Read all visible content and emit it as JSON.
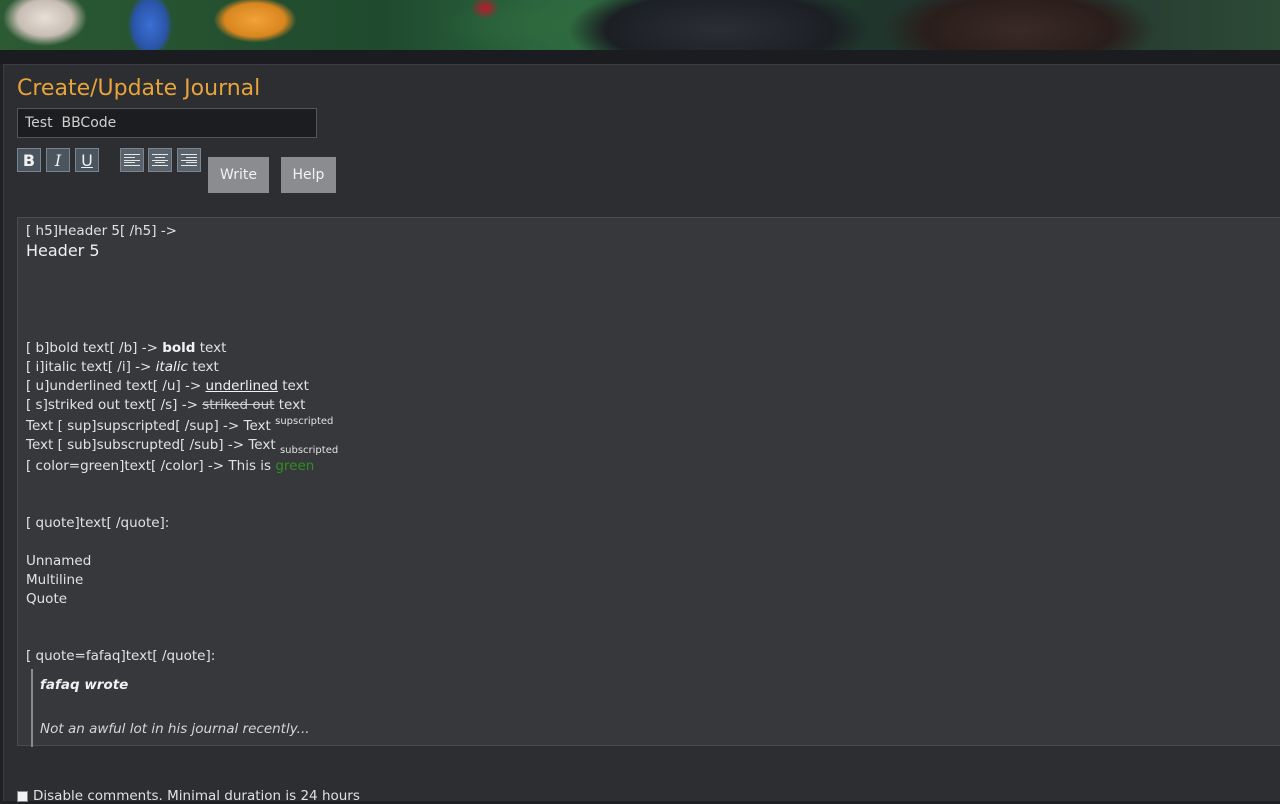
{
  "page": {
    "title": "Create/Update Journal"
  },
  "form": {
    "journal_title_value": "Test  BBCode"
  },
  "toolbar": {
    "bold_label": "B",
    "italic_label": "I",
    "underline_label": "U",
    "write_label": "Write",
    "help_label": "Help"
  },
  "preview": {
    "h5_code": "[ h5]Header 5[ /h5] ->",
    "h5_rendered": "Header 5",
    "bold": {
      "code": "[ b]bold text[ /b] -> ",
      "styled": "bold",
      "suffix": " text"
    },
    "italic": {
      "code": "[ i]italic text[ /i] -> ",
      "styled": "italic",
      "suffix": " text"
    },
    "underline": {
      "code": "[ u]underlined text[ /u] -> ",
      "styled": "underlined",
      "suffix": " text"
    },
    "strike": {
      "code": "[ s]striked out text[ /s] -> ",
      "styled": "striked out",
      "suffix": " text"
    },
    "sup": {
      "code": "Text [ sup]supscripted[ /sup] -> Text ",
      "styled": "supscripted"
    },
    "sub": {
      "code": "Text [ sub]subscrupted[ /sub] -> Text ",
      "styled": "subscripted"
    },
    "color": {
      "code": "[ color=green]text[ /color] -> This is ",
      "styled": "green",
      "color": "#2f8f1f"
    },
    "quote_code": "[ quote]text[ /quote]:",
    "quote_lines": [
      "Unnamed",
      "Multiline",
      "Quote"
    ],
    "named_quote_code": "[ quote=fafaq]text[ /quote]:",
    "named_quote_author": "fafaq wrote",
    "named_quote_body": "Not an awful lot in his journal recently..."
  },
  "options": {
    "disable_comments_label": "Disable comments. Minimal duration is 24 hours"
  },
  "colors": {
    "accent": "#e8a33a",
    "background": "#1f2124",
    "panel": "#2c2e32",
    "preview_bg": "#36383c",
    "button": "#8a8c90"
  }
}
